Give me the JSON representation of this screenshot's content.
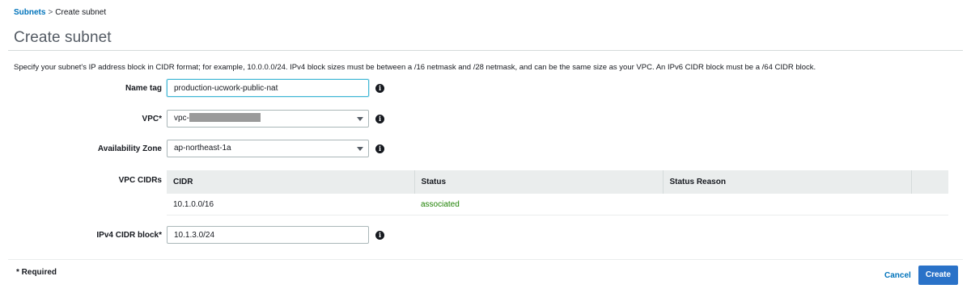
{
  "breadcrumb": {
    "parent": "Subnets",
    "separator": ">",
    "current": "Create subnet"
  },
  "page_title": "Create subnet",
  "description": "Specify your subnet's IP address block in CIDR format; for example, 10.0.0.0/24. IPv4 block sizes must be between a /16 netmask and /28 netmask, and can be the same size as your VPC. An IPv6 CIDR block must be a /64 CIDR block.",
  "form": {
    "name_tag": {
      "label": "Name tag",
      "value": "production-ucwork-public-nat",
      "info_icon": "info-icon"
    },
    "vpc": {
      "label": "VPC*",
      "value_prefix": "vpc-",
      "value_masked": true,
      "info_icon": "info-icon"
    },
    "availability_zone": {
      "label": "Availability Zone",
      "value": "ap-northeast-1a",
      "info_icon": "info-icon"
    },
    "vpc_cidrs": {
      "label": "VPC CIDRs",
      "columns": [
        "CIDR",
        "Status",
        "Status Reason"
      ],
      "rows": [
        {
          "cidr": "10.1.0.0/16",
          "status": "associated",
          "reason": ""
        }
      ],
      "status_color": "#1d8102"
    },
    "ipv4_cidr": {
      "label": "IPv4 CIDR block*",
      "value": "10.1.3.0/24",
      "info_icon": "info-icon"
    }
  },
  "footer": {
    "required_note": "* Required",
    "cancel_label": "Cancel",
    "create_label": "Create"
  },
  "colors": {
    "link": "#0073bb",
    "primary_button": "#2a72c8",
    "focus_border": "#44b9d6"
  }
}
